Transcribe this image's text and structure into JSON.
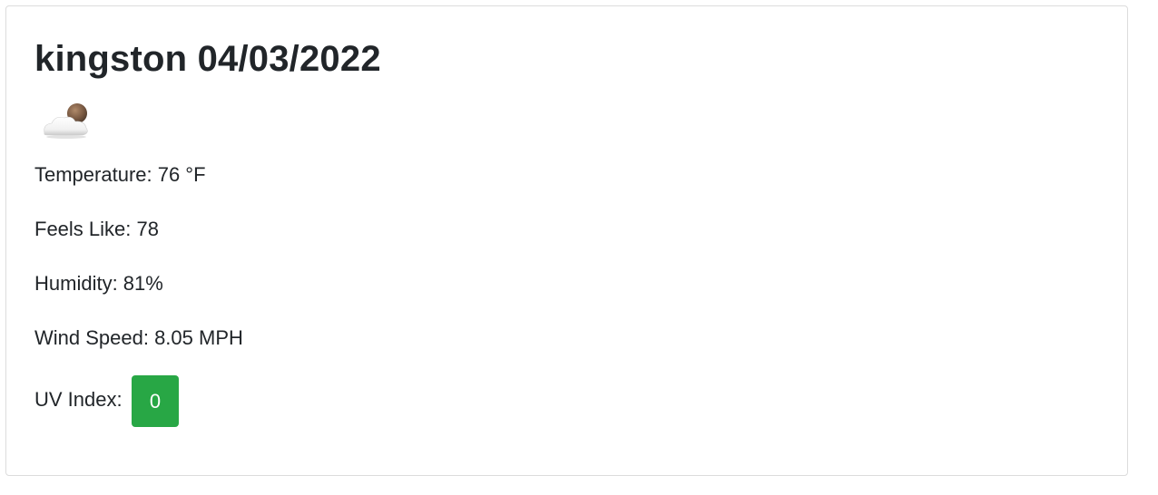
{
  "card": {
    "title": "kingston 04/03/2022",
    "weather_icon": "partly-cloudy-night-icon",
    "temperature": "Temperature: 76 °F",
    "feels_like": "Feels Like: 78",
    "humidity": "Humidity: 81%",
    "wind_speed": "Wind Speed: 8.05 MPH",
    "uv_label": "UV Index:",
    "uv_value": "0",
    "uv_color": "#28a745"
  }
}
